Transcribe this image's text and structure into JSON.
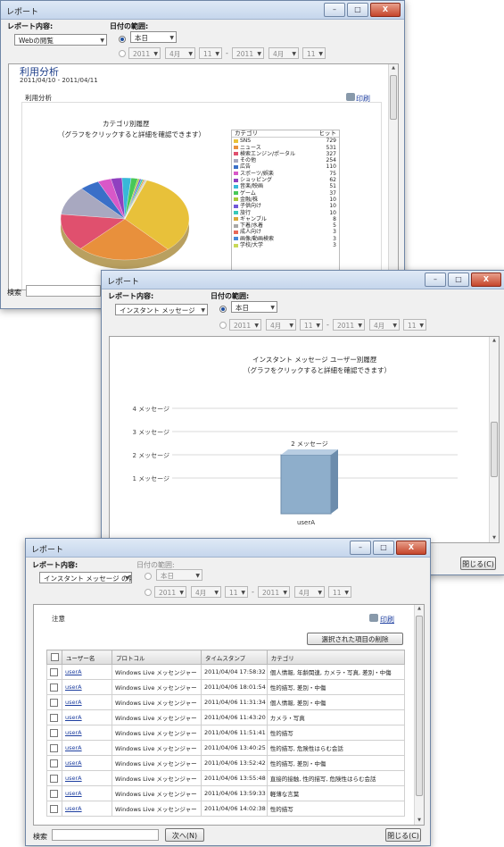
{
  "win1": {
    "title": "レポート",
    "btn_min": "–",
    "btn_max": "□",
    "btn_close": "X",
    "report_label": "レポート内容:",
    "report_value": "Webの閲覧",
    "date_label": "日付の範囲:",
    "date_preset": "本日",
    "from_year": "2011",
    "from_month": "4月",
    "from_day": "11",
    "to_year": "2011",
    "to_month": "4月",
    "to_day": "11",
    "dash": "-",
    "page_title": "利用分析",
    "date_range_text": "2011/04/10 - 2011/04/11",
    "section_label": "利用分析",
    "print": "印刷",
    "chart_title": "カテゴリ別履歴",
    "chart_subtitle": "（グラフをクリックすると詳細を確認できます）",
    "legend_head_cat": "カテゴリ",
    "legend_head_hit": "ヒット",
    "search_label": "検索"
  },
  "win2": {
    "title": "レポート",
    "btn_min": "–",
    "btn_max": "□",
    "btn_close": "X",
    "report_label": "レポート内容:",
    "report_value": "インスタント メッセージ",
    "date_label": "日付の範囲:",
    "date_preset": "本日",
    "from_year": "2011",
    "from_month": "4月",
    "from_day": "11",
    "to_year": "2011",
    "to_month": "4月",
    "to_day": "11",
    "dash": "-",
    "chart_title": "インスタント メッセージ ユーザー別履歴",
    "chart_subtitle": "（グラフをクリックすると詳細を確認できます）",
    "close_button": "閉じる(C)"
  },
  "win3": {
    "title": "レポート",
    "btn_min": "–",
    "btn_max": "□",
    "btn_close": "X",
    "report_label": "レポート内容:",
    "report_value": "インスタント メッセージ の警告",
    "date_label": "日付の範囲:",
    "date_preset": "本日",
    "from_year": "2011",
    "from_month": "4月",
    "from_day": "11",
    "to_year": "2011",
    "to_month": "4月",
    "to_day": "11",
    "dash": "-",
    "section_label": "注意",
    "print": "印刷",
    "delete_button": "選択された項目の削除",
    "columns": [
      "ユーザー名",
      "プロトコル",
      "タイムスタンプ",
      "カテゴリ"
    ],
    "rows": [
      {
        "user": "userA",
        "protocol": "Windows Live メッセンジャー",
        "time": "2011/04/04 17:58:32",
        "category": "個人情報, 年齢関連, カメラ・写真, 差別・中傷"
      },
      {
        "user": "userA",
        "protocol": "Windows Live メッセンジャー",
        "time": "2011/04/06 18:01:54",
        "category": "性的描写, 差別・中傷"
      },
      {
        "user": "userA",
        "protocol": "Windows Live メッセンジャー",
        "time": "2011/04/06 11:31:34",
        "category": "個人情報, 差別・中傷"
      },
      {
        "user": "userA",
        "protocol": "Windows Live メッセンジャー",
        "time": "2011/04/06 11:43:20",
        "category": "カメラ・写真"
      },
      {
        "user": "userA",
        "protocol": "Windows Live メッセンジャー",
        "time": "2011/04/06 11:51:41",
        "category": "性的描写"
      },
      {
        "user": "userA",
        "protocol": "Windows Live メッセンジャー",
        "time": "2011/04/06 13:40:25",
        "category": "性的描写, 危険性はらむ会話"
      },
      {
        "user": "userA",
        "protocol": "Windows Live メッセンジャー",
        "time": "2011/04/06 13:52:42",
        "category": "性的描写, 差別・中傷"
      },
      {
        "user": "userA",
        "protocol": "Windows Live メッセンジャー",
        "time": "2011/04/06 13:55:48",
        "category": "直接的接触, 性的描写, 危険性はらむ会話"
      },
      {
        "user": "userA",
        "protocol": "Windows Live メッセンジャー",
        "time": "2011/04/06 13:59:33",
        "category": "軽薄な言葉"
      },
      {
        "user": "userA",
        "protocol": "Windows Live メッセンジャー",
        "time": "2011/04/06 14:02:38",
        "category": "性的描写"
      }
    ],
    "search_label": "検索",
    "next_button": "次へ(N)",
    "close_button": "閉じる(C)"
  },
  "chart_data": [
    {
      "type": "pie",
      "title": "カテゴリ別履歴",
      "subtitle": "（グラフをクリックすると詳細を確認できます）",
      "legend": "right",
      "categories": [
        "SNS",
        "ニュース",
        "検索エンジン/ポータル",
        "その他",
        "広告",
        "スポーツ/娯楽",
        "ショッピング",
        "音楽/映画",
        "ゲーム",
        "金融/株",
        "子供向け",
        "旅行",
        "ギャンブル",
        "下着/水着",
        "成人向け",
        "画像/動画検索",
        "学校/大学"
      ],
      "values": [
        729,
        531,
        327,
        254,
        110,
        75,
        62,
        51,
        37,
        10,
        10,
        10,
        8,
        5,
        3,
        3,
        3
      ],
      "colors": [
        "#e8c13a",
        "#e8903c",
        "#e0506e",
        "#a8a8c0",
        "#3a6fc8",
        "#d858c8",
        "#9040c0",
        "#38b8d8",
        "#48c858",
        "#a8c838",
        "#7058d8",
        "#38c8b8",
        "#d8a838",
        "#a8a8a8",
        "#e86858",
        "#4888d8",
        "#c8d858"
      ]
    },
    {
      "type": "bar",
      "title": "インスタント メッセージ ユーザー別履歴",
      "subtitle": "（グラフをクリックすると詳細を確認できます）",
      "categories": [
        "userA"
      ],
      "values": [
        2
      ],
      "data_labels": [
        "2 メッセージ"
      ],
      "ylim": [
        0,
        4
      ],
      "y_ticks": [
        1,
        2,
        3,
        4
      ],
      "y_tick_labels": [
        "1 メッセージ",
        "2 メッセージ",
        "3 メッセージ",
        "4 メッセージ"
      ],
      "grid": true
    }
  ]
}
